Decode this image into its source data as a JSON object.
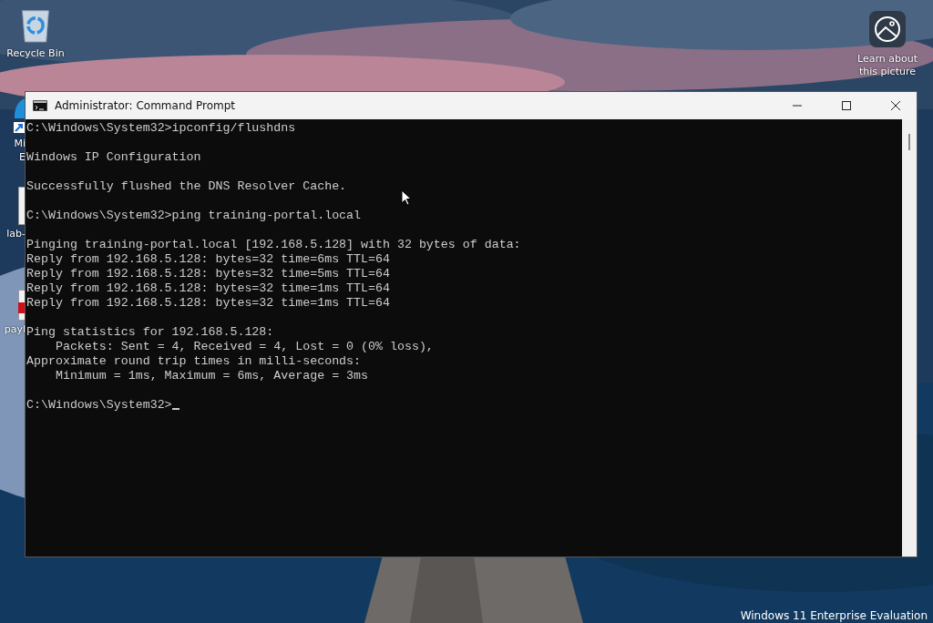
{
  "desktop": {
    "icons": [
      {
        "kind": "recycle",
        "label_lines": [
          "Recycle Bin"
        ]
      },
      {
        "kind": "edge",
        "label_lines": [
          "Mi",
          "E"
        ]
      },
      {
        "kind": "file",
        "label_lines": [
          "lab-"
        ]
      },
      {
        "kind": "redfile",
        "label_lines": [
          "payl"
        ]
      }
    ],
    "spotlight": {
      "label_lines": [
        "Learn about",
        "this picture"
      ]
    },
    "watermark": "Windows 11 Enterprise Evaluation"
  },
  "window": {
    "title": "Administrator: Command Prompt",
    "console": {
      "blocks": [
        [
          "C:\\Windows\\System32>ipconfig/flushdns"
        ],
        [
          "Windows IP Configuration"
        ],
        [
          "Successfully flushed the DNS Resolver Cache."
        ],
        [
          "C:\\Windows\\System32>ping training-portal.local"
        ],
        [
          "Pinging training-portal.local [192.168.5.128] with 32 bytes of data:",
          "Reply from 192.168.5.128: bytes=32 time=6ms TTL=64",
          "Reply from 192.168.5.128: bytes=32 time=5ms TTL=64",
          "Reply from 192.168.5.128: bytes=32 time=1ms TTL=64",
          "Reply from 192.168.5.128: bytes=32 time=1ms TTL=64"
        ],
        [
          "Ping statistics for 192.168.5.128:",
          "    Packets: Sent = 4, Received = 4, Lost = 0 (0% loss),",
          "Approximate round trip times in milli-seconds:",
          "    Minimum = 1ms, Maximum = 6ms, Average = 3ms"
        ],
        [
          "C:\\Windows\\System32>"
        ]
      ],
      "caret": true
    }
  }
}
